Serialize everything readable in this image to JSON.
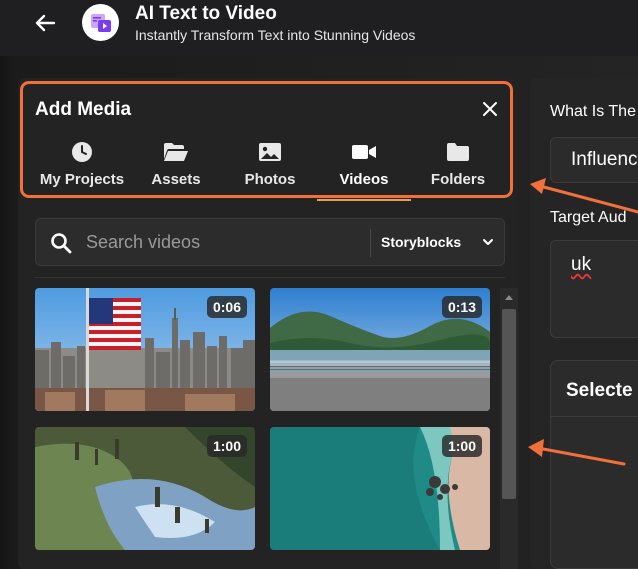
{
  "header": {
    "title": "AI Text to Video",
    "subtitle": "Instantly Transform Text into Stunning Videos"
  },
  "media_panel": {
    "title": "Add Media",
    "tabs": [
      {
        "label": "My Projects",
        "icon": "clock-icon"
      },
      {
        "label": "Assets",
        "icon": "open-folder-icon"
      },
      {
        "label": "Photos",
        "icon": "image-icon"
      },
      {
        "label": "Videos",
        "icon": "video-camera-icon",
        "active": true
      },
      {
        "label": "Folders",
        "icon": "folder-icon"
      }
    ],
    "search": {
      "placeholder": "Search videos",
      "source": "Storyblocks"
    },
    "videos": [
      {
        "duration": "0:06"
      },
      {
        "duration": "0:13"
      },
      {
        "duration": "1:00"
      },
      {
        "duration": "1:00"
      }
    ]
  },
  "form": {
    "question_label": "What Is The",
    "question_value": "Influenc",
    "target_label": "Target Aud",
    "target_value": "uk",
    "selected_title": "Selecte"
  },
  "colors": {
    "accent": "#f2703c",
    "tab_underline": "#e8a33d",
    "background": "#1f1f21"
  }
}
